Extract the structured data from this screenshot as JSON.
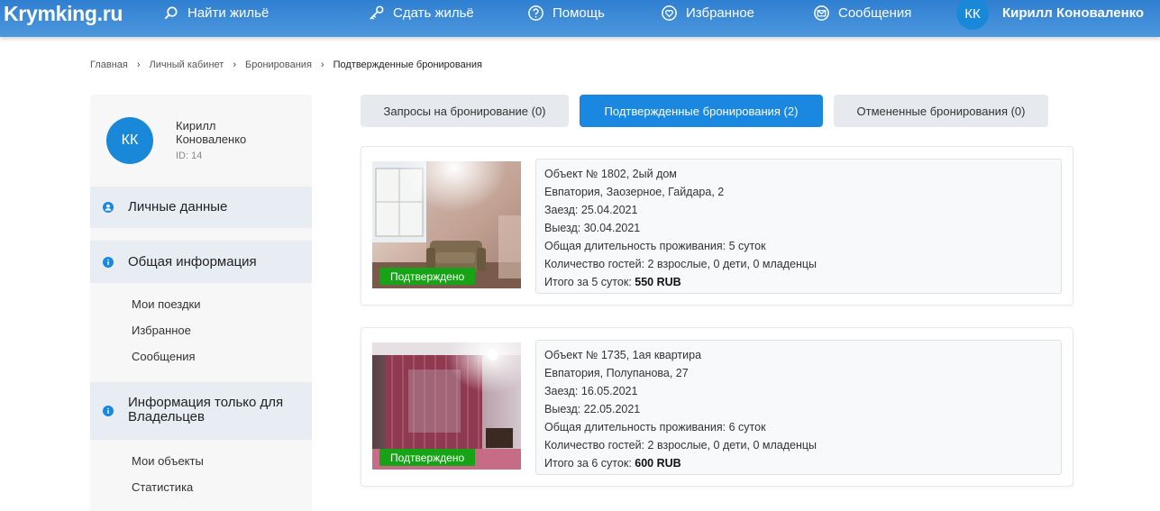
{
  "header": {
    "logo": "Krymking.ru",
    "nav": [
      {
        "label": "Найти жильё",
        "icon": "search-icon"
      },
      {
        "label": "Сдать жильё",
        "icon": "key-icon"
      },
      {
        "label": "Помощь",
        "icon": "help-icon"
      },
      {
        "label": "Избранное",
        "icon": "heart-icon"
      },
      {
        "label": "Сообщения",
        "icon": "mail-icon"
      }
    ],
    "user_initials": "КК",
    "user_name": "Кирилл Коноваленко"
  },
  "breadcrumb": {
    "items": [
      "Главная",
      "Личный кабинет",
      "Бронирования"
    ],
    "current": "Подтвержденные бронирования",
    "separator": "›"
  },
  "sidebar": {
    "initials": "КК",
    "name": "Кирилл Коноваленко",
    "id_label": "ID: 14",
    "sections": [
      {
        "label": "Личные данные",
        "icon": "user-icon"
      },
      {
        "label": "Общая информация",
        "icon": "info-icon"
      },
      {
        "label": "Информация только для Владельцев",
        "icon": "info-icon"
      }
    ],
    "general_items": [
      "Мои поездки",
      "Избранное",
      "Сообщения"
    ],
    "owner_items": [
      "Мои объекты",
      "Статистика"
    ]
  },
  "tabs": [
    {
      "label": "Запросы на бронирование (0)",
      "active": false
    },
    {
      "label": "Подтвержденные бронирования (2)",
      "active": true
    },
    {
      "label": "Отмененные бронирования (0)",
      "active": false
    }
  ],
  "bookings": [
    {
      "status": "Подтверждено",
      "object": "Объект № 1802, 2ый дом",
      "address": "Евпатория, Заозерное, Гайдара, 2",
      "checkin": "Заезд: 25.04.2021",
      "checkout": "Выезд: 30.04.2021",
      "duration": "Общая длительность проживания: 5 суток",
      "guests": "Количество гостей: 2 взрослые, 0 дети, 0 младенцы",
      "total_label": "Итого за 5 суток:",
      "total_value": "550 RUB"
    },
    {
      "status": "Подтверждено",
      "object": "Объект № 1735, 1ая квартира",
      "address": "Евпатория, Полупанова, 27",
      "checkin": "Заезд: 16.05.2021",
      "checkout": "Выезд: 22.05.2021",
      "duration": "Общая длительность проживания: 6 суток",
      "guests": "Количество гостей: 2 взрослые, 0 дети, 0 младенцы",
      "total_label": "Итого за 6 суток:",
      "total_value": "600 RUB"
    }
  ],
  "colors": {
    "header": "#3b88d6",
    "accent": "#1a88e0",
    "status_green": "#16a316"
  }
}
